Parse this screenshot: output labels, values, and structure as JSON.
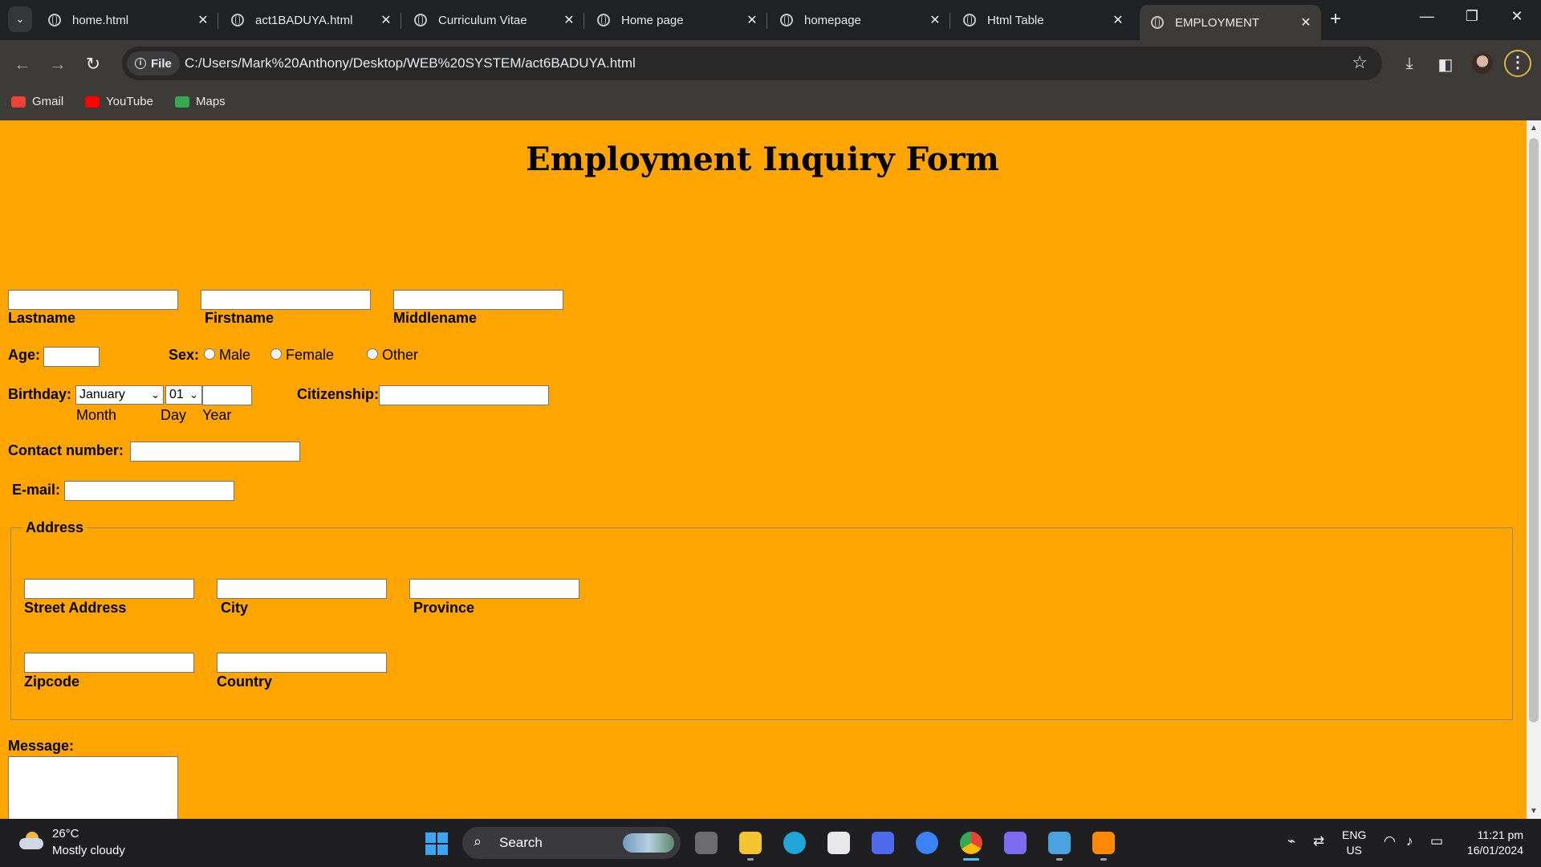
{
  "browser": {
    "tabs": [
      {
        "title": "home.html"
      },
      {
        "title": "act1BADUYA.html"
      },
      {
        "title": "Curriculum Vitae"
      },
      {
        "title": "Home page"
      },
      {
        "title": "homepage"
      },
      {
        "title": "Html Table"
      },
      {
        "title": "EMPLOYMENT",
        "active": true
      }
    ],
    "file_chip": "File",
    "url": "C:/Users/Mark%20Anthony/Desktop/WEB%20SYSTEM/act6BADUYA.html",
    "bookmarks": [
      {
        "label": "Gmail",
        "icon": "gmail-icon",
        "color": "#ea4335"
      },
      {
        "label": "YouTube",
        "icon": "youtube-icon",
        "color": "#ff0000"
      },
      {
        "label": "Maps",
        "icon": "maps-icon",
        "color": "#34a853"
      }
    ]
  },
  "form": {
    "heading": "Employment Inquiry Form",
    "background_color": "#ffa500",
    "name_labels": {
      "last": "Lastname",
      "first": "Firstname",
      "middle": "Middlename"
    },
    "age_label": "Age:",
    "sex_label": "Sex:",
    "sex_options": [
      "Male",
      "Female",
      "Other"
    ],
    "birthday_label": "Birthday:",
    "birthday": {
      "month": "January",
      "day": "01",
      "year": ""
    },
    "birthday_sub": {
      "month": "Month",
      "day": "Day",
      "year": "Year"
    },
    "citizenship_label": "Citizenship:",
    "contact_label": "Contact number:",
    "email_label": "E-mail:",
    "address": {
      "legend": "Address",
      "street": "Street Address",
      "city": "City",
      "province": "Province",
      "zipcode": "Zipcode",
      "country": "Country"
    },
    "message_label": "Message:"
  },
  "taskbar": {
    "temperature": "26°C",
    "condition": "Mostly cloudy",
    "search_label": "Search",
    "lang_top": "ENG",
    "lang_bottom": "US",
    "time": "11:21 pm",
    "date": "16/01/2024"
  }
}
